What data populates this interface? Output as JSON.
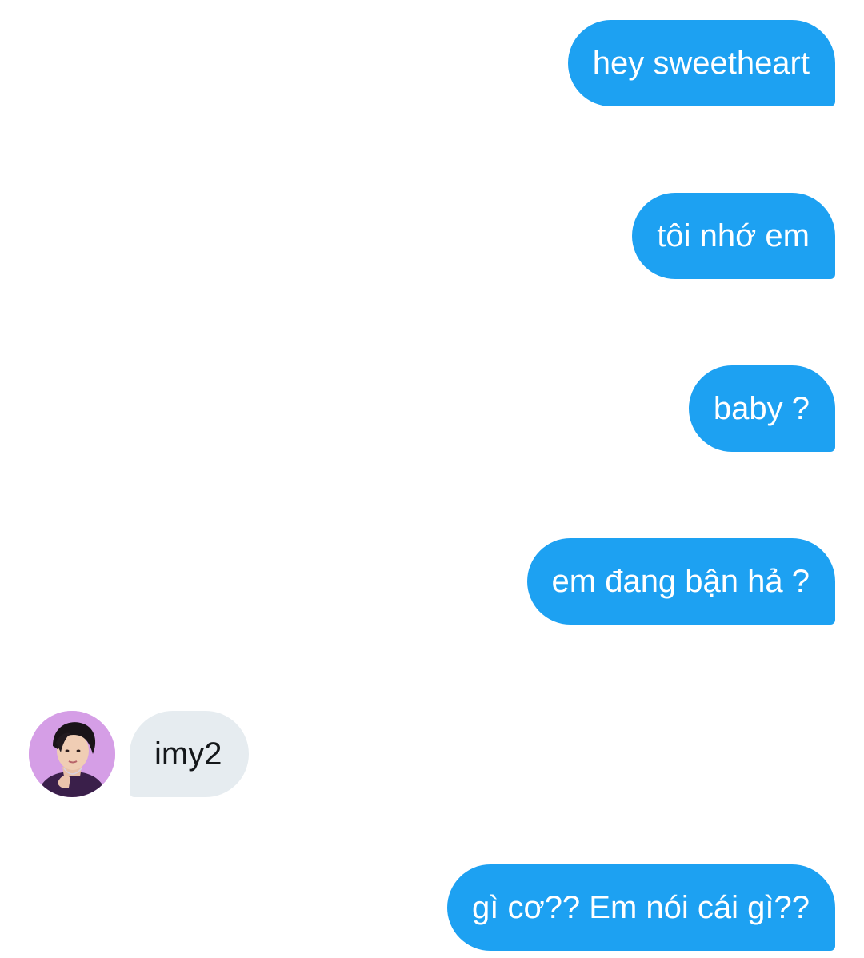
{
  "conversation": {
    "messages": [
      {
        "direction": "outgoing",
        "text": "hey sweetheart"
      },
      {
        "direction": "outgoing",
        "text": "tôi nhớ em"
      },
      {
        "direction": "outgoing",
        "text": "baby ?"
      },
      {
        "direction": "outgoing",
        "text": "em đang bận hả ?"
      },
      {
        "direction": "incoming",
        "text": "imy2"
      },
      {
        "direction": "outgoing",
        "text": "gì cơ?? Em nói cái gì??"
      }
    ]
  },
  "colors": {
    "outgoing_bubble": "#1da1f2",
    "outgoing_text": "#ffffff",
    "incoming_bubble": "#e6ecf0",
    "incoming_text": "#14171a",
    "avatar_background": "#d59ee6"
  },
  "icons": {
    "avatar": "user-profile-photo"
  }
}
